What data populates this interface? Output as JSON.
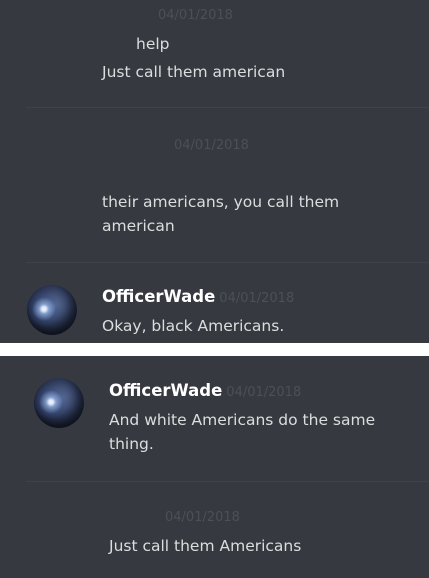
{
  "messages_top": [
    {
      "timestamp": "04/01/2018",
      "lines": [
        "help",
        "Just call them american"
      ]
    },
    {
      "timestamp": "04/01/2018",
      "text": "their americans, you call them american"
    },
    {
      "author": "OfficerWade",
      "timestamp": "04/01/2018",
      "text": "Okay, black Americans."
    }
  ],
  "messages_bottom": [
    {
      "author": "OfficerWade",
      "timestamp": "04/01/2018",
      "text": "And white Americans do the same thing."
    },
    {
      "timestamp": "04/01/2018",
      "text": "Just call them Americans"
    }
  ]
}
